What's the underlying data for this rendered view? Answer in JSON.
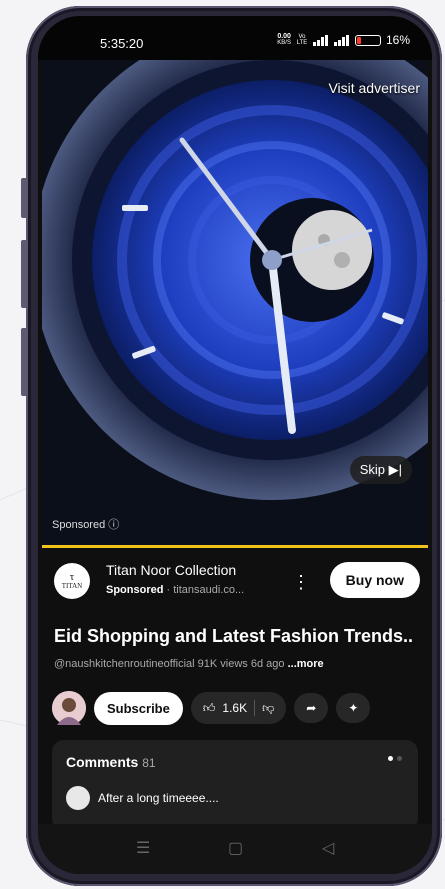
{
  "status": {
    "time": "5:35:20",
    "net_speed": "0.00",
    "net_unit": "KB/S",
    "signal_label": "Vo LTE",
    "battery_pct": "16%"
  },
  "ad": {
    "visit_label": "Visit advertiser",
    "skip_label": "Skip",
    "sponsored_overlay": "Sponsored",
    "brand_logo_text": "TITAN",
    "title": "Titan Noor Collection",
    "sponsored_label": "Sponsored",
    "sponsored_domain": "· titansaudi.co...",
    "buy_label": "Buy now"
  },
  "video": {
    "title": "Eid Shopping and Latest  Fashion Trends..",
    "channel": "@naushkitchenroutineofficial",
    "views": "91K views",
    "age": "6d ago",
    "more_label": "...more"
  },
  "actions": {
    "subscribe_label": "Subscribe",
    "likes": "1.6K"
  },
  "comments": {
    "label": "Comments",
    "count": "81",
    "first_comment": "After a long timeeee...."
  },
  "colors": {
    "accent_progress": "#f1c21b",
    "watch_blue": "#1e3fbf",
    "background": "#0f0f0f"
  },
  "icons": [
    "info-icon",
    "skip-icon",
    "kebab-icon",
    "thumbs-up-icon",
    "thumbs-down-icon",
    "share-icon",
    "sparkle-icon",
    "menu-icon",
    "home-icon",
    "back-icon"
  ]
}
